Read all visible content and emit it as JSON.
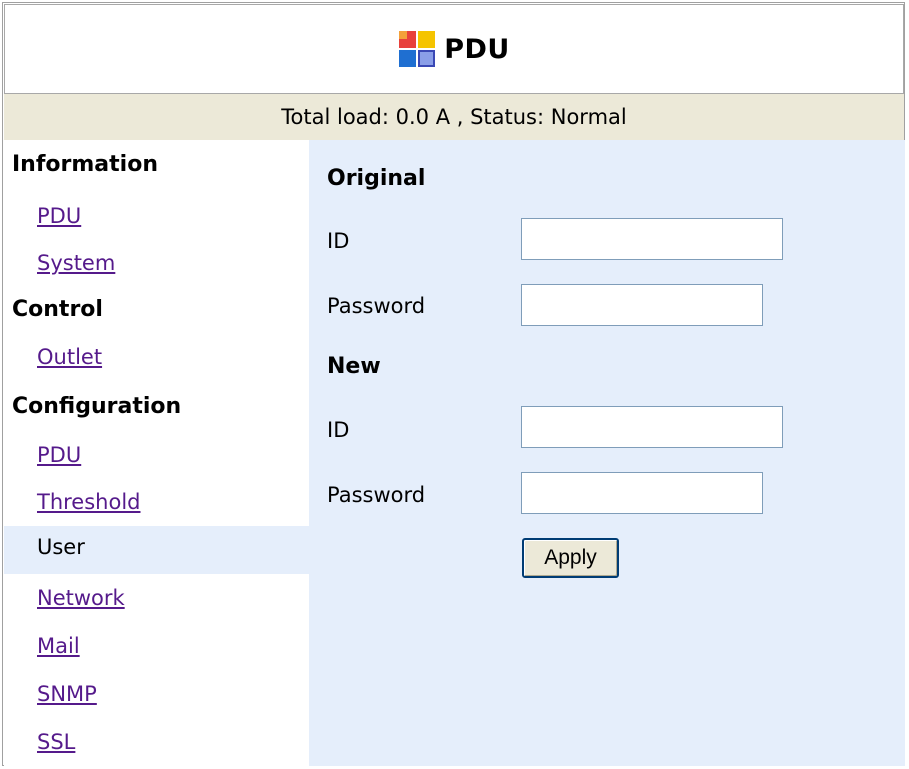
{
  "header": {
    "title": "PDU",
    "logo_icon": "pdu-logo-icon"
  },
  "status": {
    "text": "Total load: 0.0 A , Status: Normal"
  },
  "sidebar": {
    "sections": [
      {
        "title": "Information",
        "items": [
          "PDU",
          "System"
        ]
      },
      {
        "title": "Control",
        "items": [
          "Outlet"
        ]
      },
      {
        "title": "Configuration",
        "items": [
          "PDU",
          "Threshold",
          "User",
          "Network",
          "Mail",
          "SNMP",
          "SSL"
        ]
      }
    ],
    "active_item": "User"
  },
  "form": {
    "original_heading": "Original",
    "new_heading": "New",
    "id_label": "ID",
    "password_label": "Password",
    "original_id_value": "",
    "original_password_value": "",
    "new_id_value": "",
    "new_password_value": "",
    "apply_label": "Apply"
  },
  "colors": {
    "status_bg": "#ece9d8",
    "content_bg": "#e5eefb",
    "link": "#551a8b"
  }
}
